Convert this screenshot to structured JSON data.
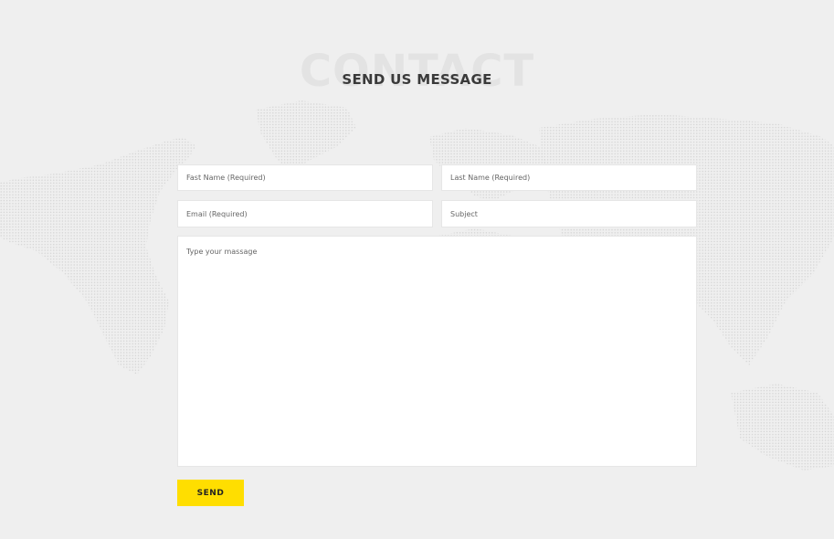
{
  "section": {
    "background_word": "CONTACT",
    "title": "SEND US MESSAGE"
  },
  "form": {
    "first_name_placeholder": "Fast Name (Required)",
    "last_name_placeholder": "Last Name (Required)",
    "email_placeholder": "Email (Required)",
    "subject_placeholder": "Subject",
    "message_placeholder": "Type your massage",
    "send_label": "SEND"
  },
  "colors": {
    "page_background": "#efefef",
    "accent": "#ffde00",
    "title_text": "#3a3a3a",
    "background_word": "#e3e3e3"
  },
  "decor": {
    "background_image": "dotted-world-map"
  }
}
